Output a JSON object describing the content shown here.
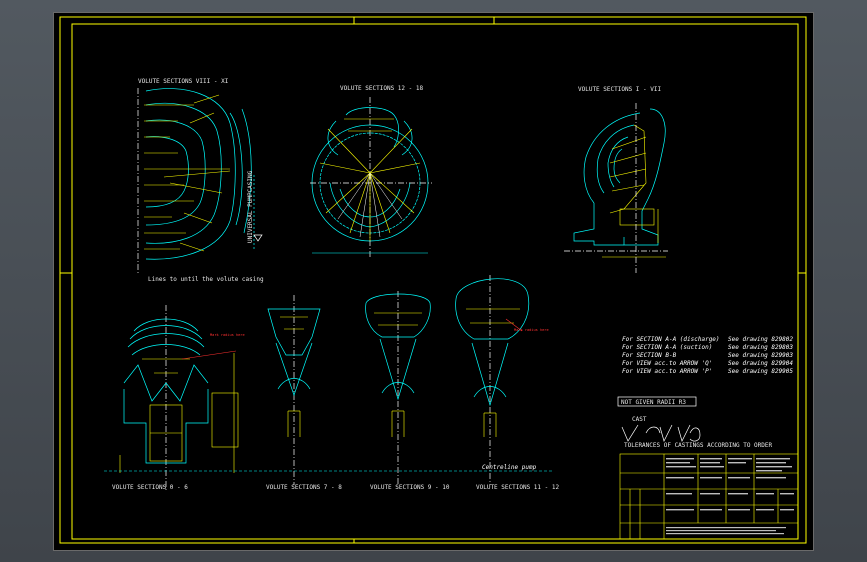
{
  "labels": {
    "sec_8_11": "VOLUTE SECTIONS  VIII - XI",
    "sec_12_18": "VOLUTE SECTIONS 12 - 18",
    "sec_1_7": "VOLUTE SECTIONS  I - VII",
    "direction": "UNIVERSAL PUMPCASING",
    "lines_note": "Lines to until the volute casing",
    "centreline": "Centreline pump",
    "sec_0_6": "VOLUTE SECTIONS  0 - 6",
    "sec_7_8": "VOLUTE SECTIONS  7 - 8",
    "sec_9_10": "VOLUTE SECTIONS  9 - 10",
    "sec_11_12": "VOLUTE SECTIONS 11 - 12",
    "red_note_1": "Mark radius here",
    "red_note_2": "Mark radius here",
    "radii": "NOT GIVEN RADII R3",
    "cast": "CAST",
    "tolerances": "TOLERANCES OF CASTINGS ACCORDING TO ORDER"
  },
  "references": [
    {
      "item": "For SECTION A-A (discharge)",
      "see": "See drawing 829802"
    },
    {
      "item": "For SECTION A-A (suction)",
      "see": "See drawing 829803"
    },
    {
      "item": "For SECTION B-B",
      "see": "See drawing 829903"
    },
    {
      "item": "For VIEW acc.to ARROW 'Q'",
      "see": "See drawing 829904"
    },
    {
      "item": "For VIEW acc.to ARROW 'P'",
      "see": "See drawing 829905"
    }
  ],
  "colors": {
    "frame": "#ffff00",
    "geometry": "#00ffff",
    "centerline": "#ffffff",
    "dimension": "#ffff60",
    "annotation": "#ff3030"
  }
}
